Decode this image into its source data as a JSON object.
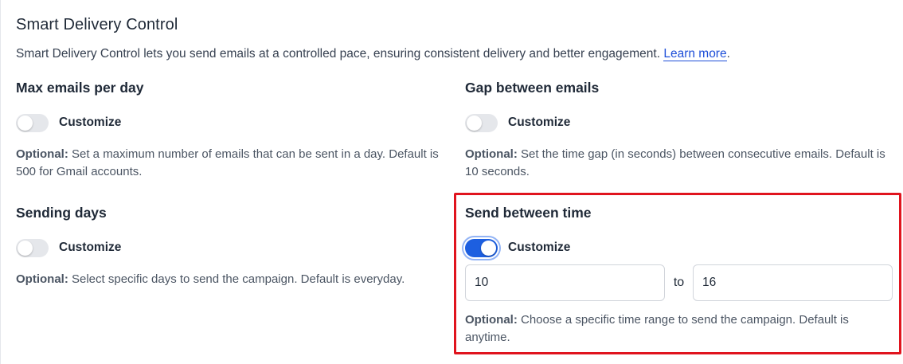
{
  "header": {
    "title": "Smart Delivery Control",
    "description": "Smart Delivery Control lets you send emails at a controlled pace, ensuring consistent delivery and better engagement.",
    "learn_more": "Learn more",
    "period": "."
  },
  "sections": {
    "max_emails": {
      "title": "Max emails per day",
      "toggle_label": "Customize",
      "enabled": false,
      "help_prefix": "Optional:",
      "help_text": " Set a maximum number of emails that can be sent in a day. Default is 500 for Gmail accounts."
    },
    "gap": {
      "title": "Gap between emails",
      "toggle_label": "Customize",
      "enabled": false,
      "help_prefix": "Optional:",
      "help_text": " Set the time gap (in seconds) between consecutive emails. Default is 10 seconds."
    },
    "sending_days": {
      "title": "Sending days",
      "toggle_label": "Customize",
      "enabled": false,
      "help_prefix": "Optional:",
      "help_text": " Select specific days to send the campaign. Default is everyday."
    },
    "send_time": {
      "title": "Send between time",
      "toggle_label": "Customize",
      "enabled": true,
      "from_value": "10",
      "to_label": "to",
      "to_value": "16",
      "help_prefix": "Optional:",
      "help_text": " Choose a specific time range to send the campaign. Default is anytime."
    }
  },
  "colors": {
    "accent": "#1d5fe0",
    "highlight": "#e0141e",
    "link": "#1d4ed8"
  }
}
